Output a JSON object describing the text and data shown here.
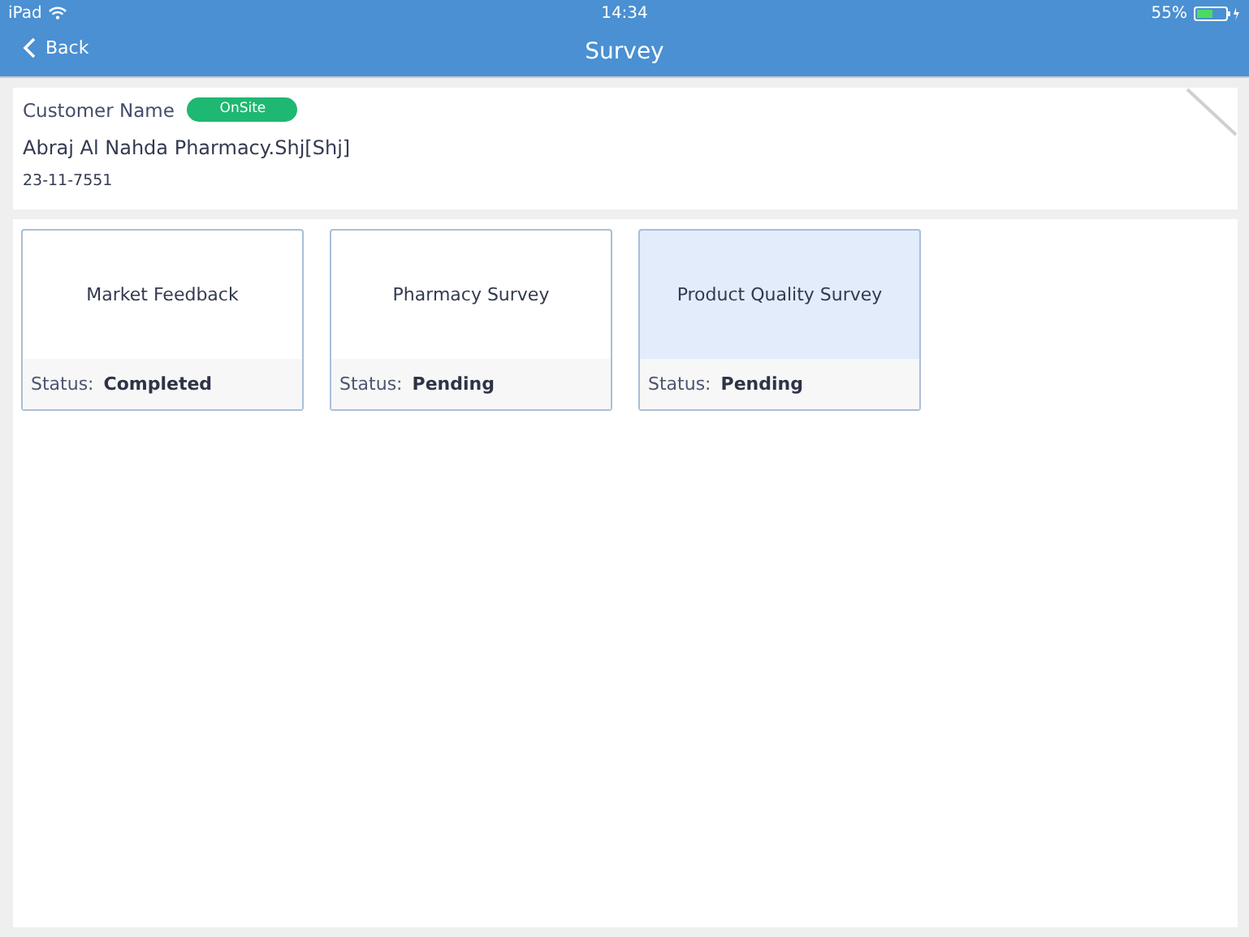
{
  "status_bar": {
    "device": "iPad",
    "time": "14:34",
    "battery": "55%"
  },
  "nav": {
    "back": "Back",
    "title": "Survey"
  },
  "customer": {
    "label": "Customer Name",
    "badge": "OnSite",
    "name": "Abraj Al Nahda Pharmacy.Shj[Shj]",
    "code": "23-11-7551"
  },
  "surveys": [
    {
      "title": "Market Feedback",
      "status_label": "Status:",
      "status": "Completed",
      "selected": false
    },
    {
      "title": "Pharmacy Survey",
      "status_label": "Status:",
      "status": "Pending",
      "selected": false
    },
    {
      "title": "Product Quality Survey",
      "status_label": "Status:",
      "status": "Pending",
      "selected": true
    }
  ]
}
